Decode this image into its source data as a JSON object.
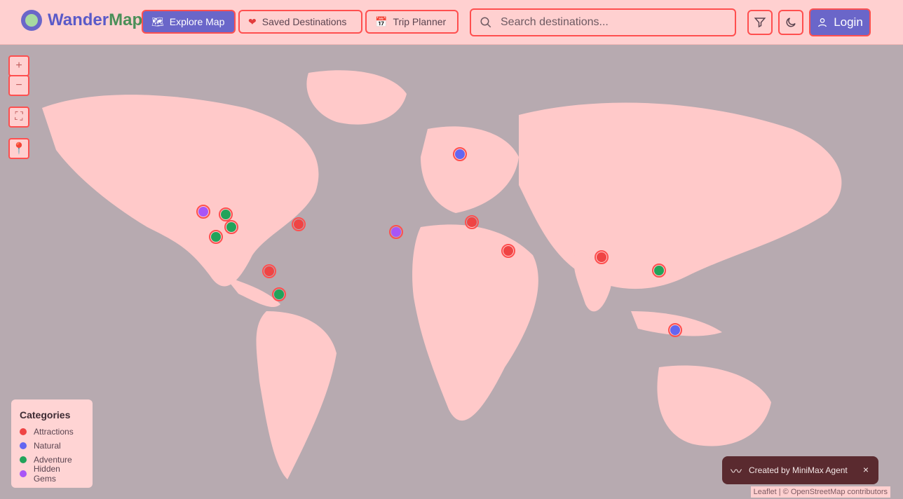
{
  "brand": {
    "name_part1": "Wander",
    "name_part2": "Map"
  },
  "nav": {
    "explore": "Explore Map",
    "saved": "Saved Destinations",
    "trip": "Trip Planner",
    "icons": {
      "explore": "map-icon",
      "saved": "heart-icon",
      "trip": "calendar-icon"
    }
  },
  "search": {
    "placeholder": "Search destinations..."
  },
  "actions": {
    "login": "Login",
    "filter_icon": "filter-icon",
    "theme_icon": "moon-icon",
    "login_icon": "user-icon"
  },
  "map": {
    "controls": [
      "zoom-in",
      "zoom-out",
      "fullscreen",
      "locate"
    ],
    "legend": {
      "title": "Categories",
      "items": [
        {
          "label": "Attractions",
          "color": "#ef4444"
        },
        {
          "label": "Natural",
          "color": "#6366f1"
        },
        {
          "label": "Adventure",
          "color": "#22a35a"
        },
        {
          "label": "Hidden Gems",
          "color": "#a855f7"
        }
      ]
    },
    "markers": [
      {
        "id": "m-sf",
        "category": "hidden-gems"
      },
      {
        "id": "m-yosemite",
        "category": "adventure"
      },
      {
        "id": "m-grand-canyon",
        "category": "adventure"
      },
      {
        "id": "m-la",
        "category": "adventure"
      },
      {
        "id": "m-nyc",
        "category": "attractions"
      },
      {
        "id": "m-azores",
        "category": "hidden-gems"
      },
      {
        "id": "m-mexico",
        "category": "attractions"
      },
      {
        "id": "m-costa-rica",
        "category": "adventure"
      },
      {
        "id": "m-norway",
        "category": "natural"
      },
      {
        "id": "m-rome",
        "category": "attractions"
      },
      {
        "id": "m-cairo",
        "category": "attractions"
      },
      {
        "id": "m-india",
        "category": "attractions"
      },
      {
        "id": "m-vietnam",
        "category": "adventure"
      },
      {
        "id": "m-bali",
        "category": "natural"
      }
    ]
  },
  "toast": {
    "text": "Created by MiniMax Agent",
    "close": "×"
  },
  "attribution": "Leaflet | © OpenStreetMap contributors",
  "colors": {
    "primary": "#6a66c9",
    "header_bg": "#ffd0d0",
    "ocean": "#b7aab0",
    "land": "#ffc9c9"
  }
}
